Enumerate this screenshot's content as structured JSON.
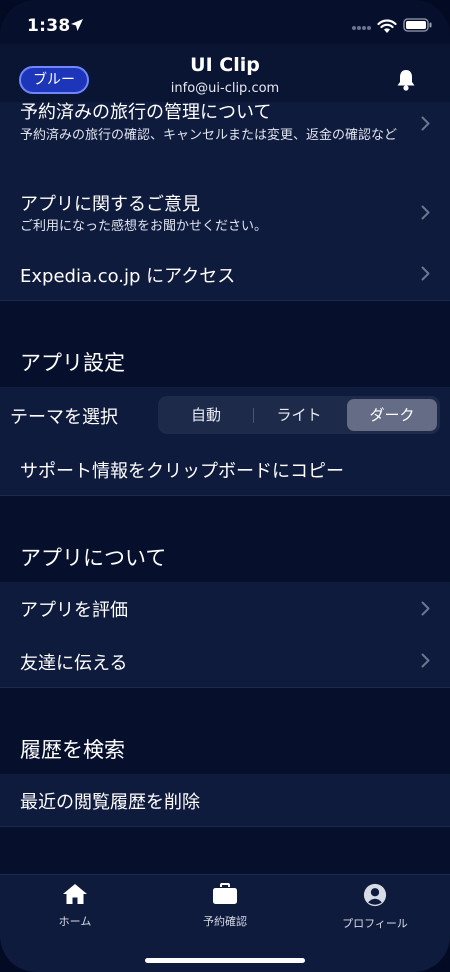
{
  "status": {
    "time": "1:38"
  },
  "header": {
    "badge": "ブルー",
    "title": "UI Clip",
    "email": "info@ui-clip.com"
  },
  "rows": {
    "trip_manage": {
      "title": "予約済みの旅行の管理について",
      "subtitle": "予約済みの旅行の確認、キャンセルまたは変更、返金の確認など"
    },
    "feedback": {
      "title": "アプリに関するご意見",
      "subtitle": "ご利用になった感想をお聞かせください。"
    },
    "expedia": {
      "title": "Expedia.co.jp にアクセス"
    }
  },
  "sections": {
    "app_settings": "アプリ設定",
    "about_app": "アプリについて",
    "search_history": "履歴を検索"
  },
  "theme": {
    "label": "テーマを選択",
    "options": [
      "自動",
      "ライト",
      "ダーク"
    ],
    "selected": "ダーク"
  },
  "copy_support": "サポート情報をクリップボードにコピー",
  "about": {
    "rate": "アプリを評価",
    "share": "友達に伝える"
  },
  "history": {
    "clear": "最近の閲覧履歴を削除"
  },
  "tabs": [
    {
      "label": "ホーム",
      "icon": "home-icon"
    },
    {
      "label": "予約確認",
      "icon": "briefcase-icon"
    },
    {
      "label": "プロフィール",
      "icon": "user-icon"
    }
  ]
}
